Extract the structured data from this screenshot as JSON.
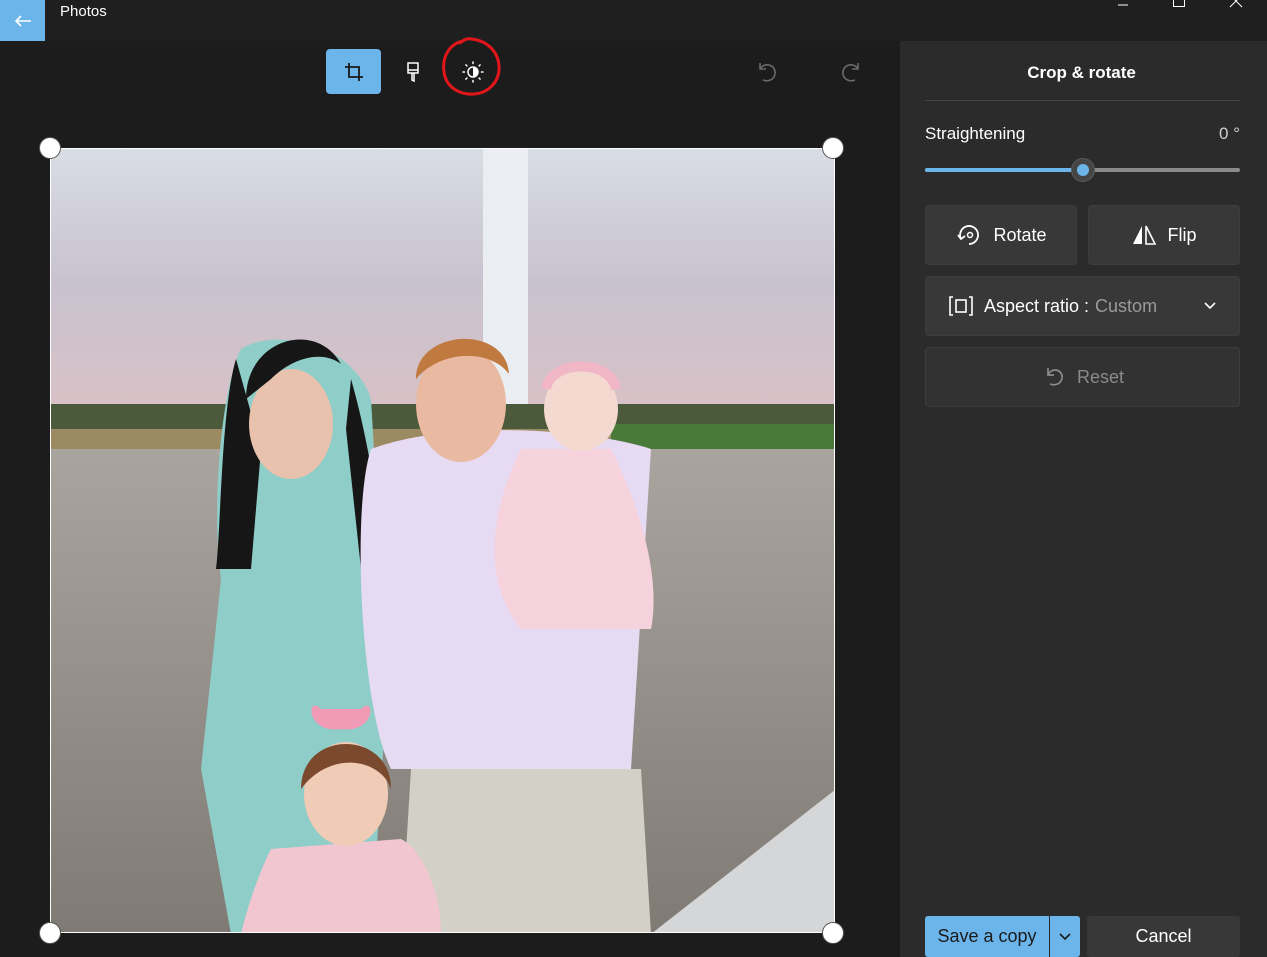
{
  "window": {
    "app_title": "Photos",
    "icons": [
      "back-arrow-icon",
      "minimize-icon",
      "maximize-icon",
      "close-icon"
    ]
  },
  "toolbar": {
    "tools": [
      {
        "name": "crop-icon",
        "active": true
      },
      {
        "name": "filter-icon",
        "active": false
      },
      {
        "name": "adjust-brightness-icon",
        "active": false
      }
    ],
    "undo_icon": "undo-icon",
    "redo_icon": "redo-icon",
    "accent_color": "#6cb5ea",
    "annotation_color": "#e0161b"
  },
  "panel": {
    "title": "Crop & rotate",
    "straightening_label": "Straightening",
    "straightening_value": "0 °",
    "straightening_fraction": 0.5,
    "rotate_label": "Rotate",
    "flip_label": "Flip",
    "aspect_label": "Aspect ratio :",
    "aspect_value": "Custom",
    "reset_label": "Reset",
    "save_label": "Save a copy",
    "cancel_label": "Cancel"
  }
}
